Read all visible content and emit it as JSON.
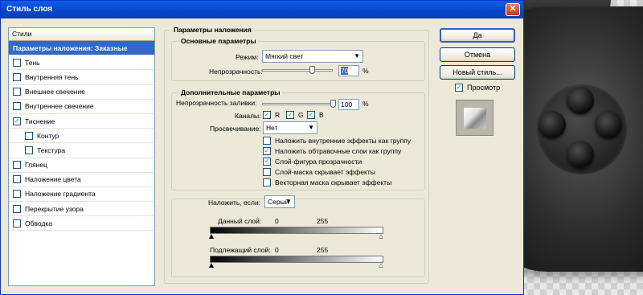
{
  "window": {
    "title": "Стиль слоя",
    "close_glyph": "✕"
  },
  "styles_panel": {
    "header": "Стили",
    "items": [
      {
        "label": "Параметры наложения: Заказные",
        "active": true,
        "has_checkbox": false,
        "checked": false,
        "indent": false
      },
      {
        "label": "Тень",
        "has_checkbox": true,
        "checked": false,
        "indent": false
      },
      {
        "label": "Внутренняя тень",
        "has_checkbox": true,
        "checked": false,
        "indent": false
      },
      {
        "label": "Внешнее свечение",
        "has_checkbox": true,
        "checked": false,
        "indent": false
      },
      {
        "label": "Внутреннее свечение",
        "has_checkbox": true,
        "checked": false,
        "indent": false
      },
      {
        "label": "Тиснение",
        "has_checkbox": true,
        "checked": true,
        "indent": false
      },
      {
        "label": "Контур",
        "has_checkbox": true,
        "checked": false,
        "indent": true
      },
      {
        "label": "Текстура",
        "has_checkbox": true,
        "checked": false,
        "indent": true
      },
      {
        "label": "Глянец",
        "has_checkbox": true,
        "checked": false,
        "indent": false
      },
      {
        "label": "Наложение цвета",
        "has_checkbox": true,
        "checked": false,
        "indent": false
      },
      {
        "label": "Наложение градиента",
        "has_checkbox": true,
        "checked": false,
        "indent": false
      },
      {
        "label": "Перекрытие узора",
        "has_checkbox": true,
        "checked": false,
        "indent": false
      },
      {
        "label": "Обводка",
        "has_checkbox": true,
        "checked": false,
        "indent": false
      }
    ]
  },
  "blending": {
    "section_title": "Параметры наложения",
    "basic": {
      "title": "Основные параметры",
      "mode_label": "Режим:",
      "mode_value": "Мягкий свет",
      "opacity_label": "Непрозрачность:",
      "opacity_value": "70",
      "opacity_unit": "%",
      "opacity_level": 0.7
    },
    "advanced": {
      "title": "Дополнительные параметры",
      "fill_label": "Непрозрачность заливки:",
      "fill_value": "100",
      "fill_unit": "%",
      "fill_level": 1.0,
      "channels_label": "Каналы:",
      "channels": [
        {
          "label": "R",
          "checked": true
        },
        {
          "label": "G",
          "checked": true
        },
        {
          "label": "B",
          "checked": true
        }
      ],
      "knockout_label": "Просвечивание:",
      "knockout_value": "Нет",
      "options": [
        {
          "label": "Наложить внутренние эффекты как группу",
          "checked": false
        },
        {
          "label": "Наложить обтравочные слои как группу",
          "checked": true
        },
        {
          "label": "Слой-фигура прозрачности",
          "checked": true
        },
        {
          "label": "Слой-маска скрывает эффекты",
          "checked": false
        },
        {
          "label": "Векторная маска скрывает эффекты",
          "checked": false
        }
      ]
    },
    "blend_if": {
      "label": "Наложить, если:",
      "value": "Серый",
      "this_layer_label": "Данный слой:",
      "this_layer_low": "0",
      "this_layer_high": "255",
      "underlying_label": "Подлежащий слой:",
      "underlying_low": "0",
      "underlying_high": "255"
    }
  },
  "buttons": {
    "ok": "Да",
    "cancel": "Отмена",
    "new_style": "Новый стиль...",
    "preview_label": "Просмотр",
    "preview_checked": true
  },
  "colors": {
    "title_bar": "#0a5fe6",
    "selection": "#316ac5",
    "dialog_bg": "#ece9d8"
  }
}
